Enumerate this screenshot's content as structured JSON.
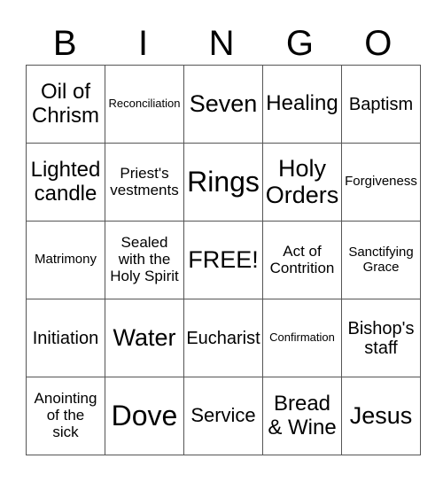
{
  "header": {
    "letters": [
      "B",
      "I",
      "N",
      "G",
      "O"
    ]
  },
  "grid": {
    "rows": [
      [
        "Oil of\nChrism",
        "Reconciliation",
        "Seven",
        "Healing",
        "Baptism"
      ],
      [
        "Lighted\ncandle",
        "Priest's\nvestments",
        "Rings",
        "Holy\nOrders",
        "Forgiveness"
      ],
      [
        "Matrimony",
        "Sealed\nwith the\nHoly Spirit",
        "FREE!",
        "Act of\nContrition",
        "Sanctifying\nGrace"
      ],
      [
        "Initiation",
        "Water",
        "Eucharist",
        "Confirmation",
        "Bishop's\nstaff"
      ],
      [
        "Anointing\nof the\nsick",
        "Dove",
        "Service",
        "Bread\n& Wine",
        "Jesus"
      ]
    ]
  }
}
